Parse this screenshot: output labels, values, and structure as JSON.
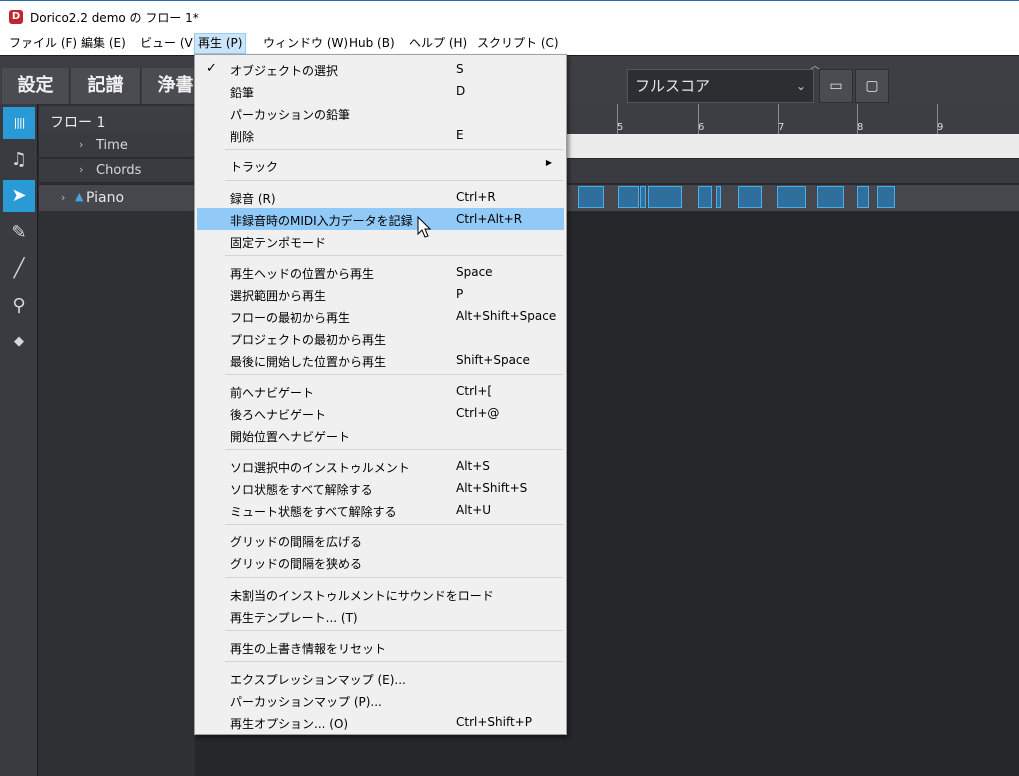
{
  "window": {
    "title": "Dorico2.2 demo の フロー 1*",
    "icon_letter": "D"
  },
  "menubar": {
    "items": [
      {
        "id": "file",
        "label": "ファイル (F)"
      },
      {
        "id": "edit",
        "label": "編集 (E)"
      },
      {
        "id": "view",
        "label": "ビュー (V)"
      },
      {
        "id": "play",
        "label": "再生 (P)"
      },
      {
        "id": "window",
        "label": "ウィンドウ (W)"
      },
      {
        "id": "hub",
        "label": "Hub (B)"
      },
      {
        "id": "help",
        "label": "ヘルプ (H)"
      },
      {
        "id": "script",
        "label": "スクリプト (C)"
      }
    ],
    "open_menu": "play"
  },
  "toolbar": {
    "modes": [
      {
        "label": "設定"
      },
      {
        "label": "記譜"
      },
      {
        "label": "浄書"
      }
    ],
    "layout_selector": "フルスコア"
  },
  "tools": [
    {
      "icon": "waveform-icon",
      "glyph": "||||",
      "active": false,
      "highlight": true
    },
    {
      "icon": "note-icon",
      "glyph": "♫",
      "active": false
    },
    {
      "icon": "arrow-select-icon",
      "glyph": "➤",
      "active": true
    },
    {
      "icon": "pencil-icon",
      "glyph": "✎",
      "active": false
    },
    {
      "icon": "line-icon",
      "glyph": "╱",
      "active": false
    },
    {
      "icon": "mallet-icon",
      "glyph": "⚲",
      "active": false
    },
    {
      "icon": "eraser-icon",
      "glyph": "◆",
      "active": false
    }
  ],
  "tracks": {
    "flow": "フロー 1",
    "rows": [
      {
        "label": "Time"
      },
      {
        "label": "Chords"
      }
    ],
    "instrument": "Piano",
    "bar_numbers": [
      "5",
      "6",
      "7",
      "8",
      "9"
    ]
  },
  "play_menu": {
    "items": [
      {
        "label": "オブジェクトの選択",
        "shortcut": "S",
        "checked": true
      },
      {
        "label": "鉛筆",
        "shortcut": "D"
      },
      {
        "label": "パーカッションの鉛筆",
        "shortcut": ""
      },
      {
        "label": "削除",
        "shortcut": "E"
      },
      {
        "label": "トラック",
        "shortcut": "",
        "submenu": true
      },
      {
        "label": "録音 (R)",
        "shortcut": "Ctrl+R"
      },
      {
        "label": "非録音時のMIDI入力データを記録",
        "shortcut": "Ctrl+Alt+R",
        "highlight": true
      },
      {
        "label": "固定テンポモード",
        "shortcut": ""
      },
      {
        "label": "再生ヘッドの位置から再生",
        "shortcut": "Space"
      },
      {
        "label": "選択範囲から再生",
        "shortcut": "P"
      },
      {
        "label": "フローの最初から再生",
        "shortcut": "Alt+Shift+Space"
      },
      {
        "label": "プロジェクトの最初から再生",
        "shortcut": ""
      },
      {
        "label": "最後に開始した位置から再生",
        "shortcut": "Shift+Space"
      },
      {
        "label": "前へナビゲート",
        "shortcut": "Ctrl+["
      },
      {
        "label": "後ろへナビゲート",
        "shortcut": "Ctrl+@"
      },
      {
        "label": "開始位置へナビゲート",
        "shortcut": ""
      },
      {
        "label": "ソロ選択中のインストゥルメント",
        "shortcut": "Alt+S"
      },
      {
        "label": "ソロ状態をすべて解除する",
        "shortcut": "Alt+Shift+S"
      },
      {
        "label": "ミュート状態をすべて解除する",
        "shortcut": "Alt+U"
      },
      {
        "label": "グリッドの間隔を広げる",
        "shortcut": ""
      },
      {
        "label": "グリッドの間隔を狭める",
        "shortcut": ""
      },
      {
        "label": "未割当のインストゥルメントにサウンドをロード",
        "shortcut": ""
      },
      {
        "label": "再生テンプレート... (T)",
        "shortcut": ""
      },
      {
        "label": "再生の上書き情報をリセット",
        "shortcut": ""
      },
      {
        "label": "エクスプレッションマップ (E)...",
        "shortcut": ""
      },
      {
        "label": "パーカッションマップ (P)...",
        "shortcut": ""
      },
      {
        "label": "再生オプション... (O)",
        "shortcut": "Ctrl+Shift+P"
      }
    ]
  },
  "colors": {
    "accent": "#2a9ad6",
    "menu_highlight": "#91c9f7",
    "menu_open": "#cce4f7",
    "note_fill": "#2e6f9e",
    "note_border": "#4aaee8"
  }
}
